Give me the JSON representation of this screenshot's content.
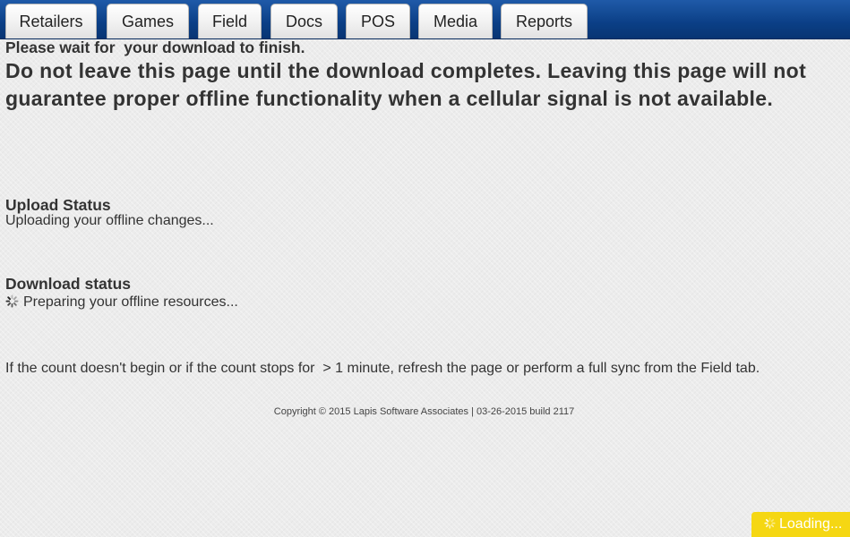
{
  "nav": {
    "tabs": [
      {
        "label": "Retailers"
      },
      {
        "label": "Games"
      },
      {
        "label": "Field"
      },
      {
        "label": "Docs"
      },
      {
        "label": "POS"
      },
      {
        "label": "Media"
      },
      {
        "label": "Reports"
      }
    ]
  },
  "main": {
    "wait_message": "Please wait for  your download to finish.",
    "warning": "Do not leave this page until the download completes. Leaving this page will not guarantee proper offline functionality when a cellular signal is not available.",
    "upload": {
      "heading": "Upload Status",
      "status": "Uploading your offline changes..."
    },
    "download": {
      "heading": "Download status",
      "status": "Preparing your offline resources..."
    },
    "instructions": "If the count doesn't begin or if the count stops for  > 1 minute, refresh the page or perform a full sync from the Field tab.",
    "copyright": "Copyright © 2015 Lapis Software Associates | 03-26-2015 build 2117"
  },
  "loading_badge": {
    "label": "Loading..."
  },
  "icons": {
    "download_spinner": "spinner-icon",
    "loading_spinner": "spinner-icon"
  },
  "colors": {
    "nav_bar": "#0b3f86",
    "loading_badge": "#f5d713",
    "text": "#333333"
  }
}
